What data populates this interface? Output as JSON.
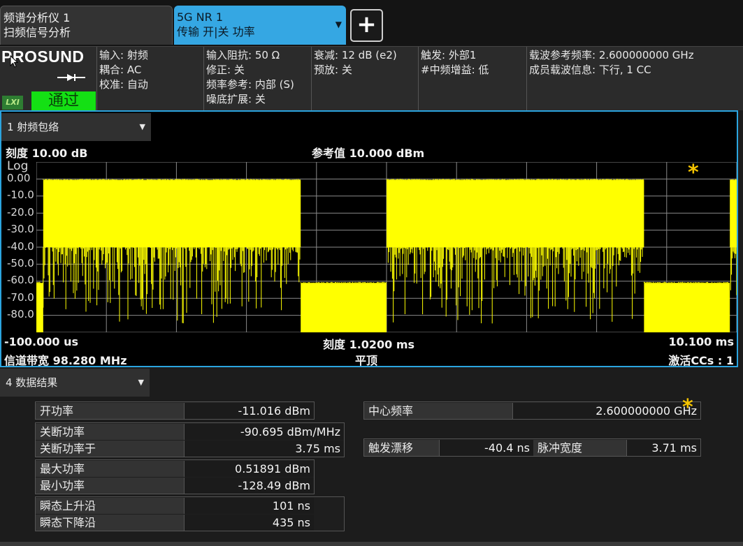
{
  "tabs": {
    "instrument_line1": "频谱分析仪 1",
    "instrument_line2": "扫频信号分析",
    "mode_line1": "5G NR 1",
    "mode_line2": "传输 开|关 功率",
    "add_label": "+"
  },
  "settings": {
    "logo": "PROSUND",
    "lxi": "LXI",
    "status": "通过",
    "col1": [
      "输入: 射频",
      "耦合: AC",
      "校准: 自动"
    ],
    "col2": [
      "输入阻抗: 50 Ω",
      "修正: 关",
      "频率参考: 内部 (S)",
      "噪底扩展: 关"
    ],
    "col3": [
      "衰减: 12 dB (e2)",
      "预放: 关"
    ],
    "col4": [
      "触发: 外部1",
      "#中频增益: 低"
    ],
    "col5": [
      "载波参考频率: 2.600000000 GHz",
      "成员载波信息: 下行, 1 CC"
    ]
  },
  "graph": {
    "window_select": "1 射频包络",
    "scale": "刻度 10.00 dB",
    "ref": "参考值 10.000 dBm",
    "log": "Log",
    "yticks": [
      "0.00",
      "-10.0",
      "-20.0",
      "-30.0",
      "-40.0",
      "-50.0",
      "-60.0",
      "-70.0",
      "-80.0"
    ],
    "start": "-100.000 us",
    "xscale": "刻度 1.0200 ms",
    "stop": "10.100 ms",
    "bandwidth": "信道带宽 98.280 MHz",
    "window_type": "平顶",
    "active_ccs": "激活CCs : 1",
    "marker_star": "*",
    "colors": {
      "trace": "#ffff00",
      "grid": "#8a8a8a",
      "border": "#2ba4df"
    }
  },
  "chart_data": {
    "type": "line",
    "title": "",
    "xlabel": "",
    "ylabel": "",
    "xlim_ms": [
      -0.1,
      10.1
    ],
    "ylim_dBm": [
      -90,
      10
    ],
    "y_scale": "log",
    "grid": true,
    "series": [
      {
        "segments": [
          {
            "t_start_ms": -0.1,
            "t_end_ms": 0.0,
            "level_dBm": -61,
            "noise_floor_dBm": -90
          },
          {
            "t_start_ms": 0.0,
            "t_end_ms": 3.75,
            "level_dBm": -0.5,
            "noise_floor_dBm": -40
          },
          {
            "t_start_ms": 3.75,
            "t_end_ms": 5.0,
            "level_dBm": -61,
            "noise_floor_dBm": -90
          },
          {
            "t_start_ms": 5.0,
            "t_end_ms": 8.75,
            "level_dBm": -0.5,
            "noise_floor_dBm": -40
          },
          {
            "t_start_ms": 8.75,
            "t_end_ms": 10.0,
            "level_dBm": -61,
            "noise_floor_dBm": -90
          },
          {
            "t_start_ms": 10.0,
            "t_end_ms": 10.1,
            "level_dBm": -0.5,
            "noise_floor_dBm": -40
          }
        ]
      }
    ]
  },
  "results": {
    "window_select": "4 数据结果",
    "on_power": {
      "label": "开功率",
      "value": "-11.016 dBm"
    },
    "off_power": {
      "label": "关断功率",
      "value": "-90.695 dBm/MHz"
    },
    "off_power_at": {
      "label": "关断功率于",
      "value": "3.75 ms"
    },
    "max_power": {
      "label": "最大功率",
      "value": "0.51891 dBm"
    },
    "min_power": {
      "label": "最小功率",
      "value": "-128.49 dBm"
    },
    "rise": {
      "label": "瞬态上升沿",
      "value": "101 ns"
    },
    "fall": {
      "label": "瞬态下降沿",
      "value": "435 ns"
    },
    "center_freq": {
      "label": "中心频率",
      "value": "2.600000000 GHz"
    },
    "trig_drift": {
      "label": "触发漂移",
      "value": "-40.4 ns"
    },
    "pulse_width": {
      "label": "脉冲宽度",
      "value": "3.71 ms"
    },
    "marker_star": "*"
  }
}
